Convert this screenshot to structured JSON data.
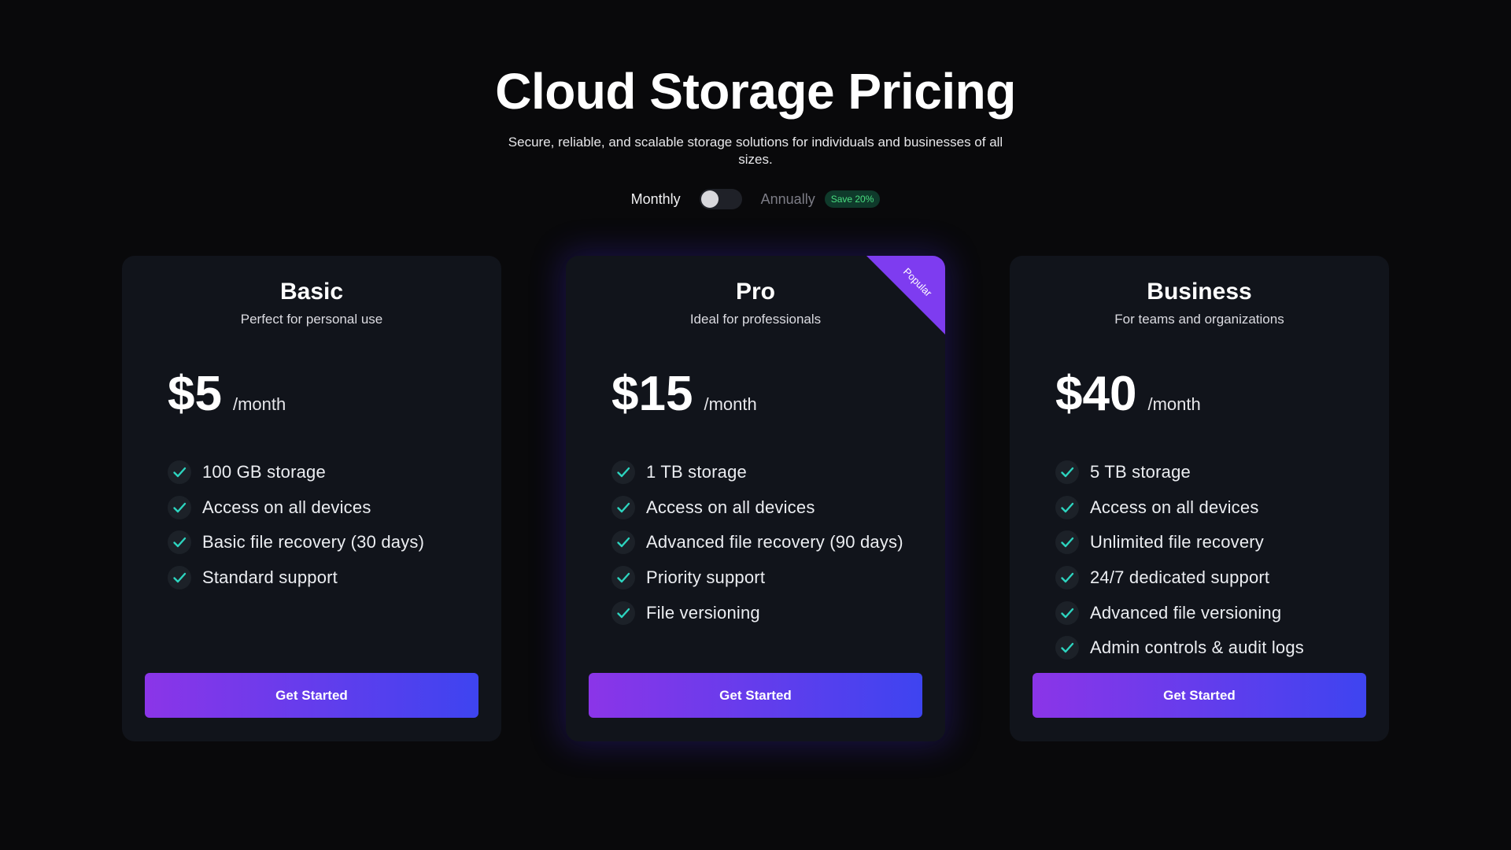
{
  "header": {
    "title": "Cloud Storage Pricing",
    "subtitle": "Secure, reliable, and scalable storage solutions for individuals and businesses of all sizes."
  },
  "billing": {
    "monthly_label": "Monthly",
    "annually_label": "Annually",
    "save_badge": "Save 20%",
    "selected": "Monthly"
  },
  "plans": [
    {
      "name": "Basic",
      "description": "Perfect for personal use",
      "price": "$5",
      "period": "/month",
      "features": [
        "100 GB storage",
        "Access on all devices",
        "Basic file recovery (30 days)",
        "Standard support"
      ],
      "cta": "Get Started"
    },
    {
      "name": "Pro",
      "description": "Ideal for professionals",
      "price": "$15",
      "period": "/month",
      "badge": "Popular",
      "features": [
        "1 TB storage",
        "Access on all devices",
        "Advanced file recovery (90 days)",
        "Priority support",
        "File versioning"
      ],
      "cta": "Get Started"
    },
    {
      "name": "Business",
      "description": "For teams and organizations",
      "price": "$40",
      "period": "/month",
      "features": [
        "5 TB storage",
        "Access on all devices",
        "Unlimited file recovery",
        "24/7 dedicated support",
        "Advanced file versioning",
        "Admin controls & audit logs"
      ],
      "cta": "Get Started"
    }
  ],
  "icons": {
    "feature": "check-icon"
  },
  "colors": {
    "background": "#09090b",
    "card": "#11141b",
    "check": "#2dd4bf",
    "cta_start": "#8b35e8",
    "cta_end": "#3e44f0",
    "badge": "#7e3cf0",
    "save_badge_text": "#4ade80"
  }
}
